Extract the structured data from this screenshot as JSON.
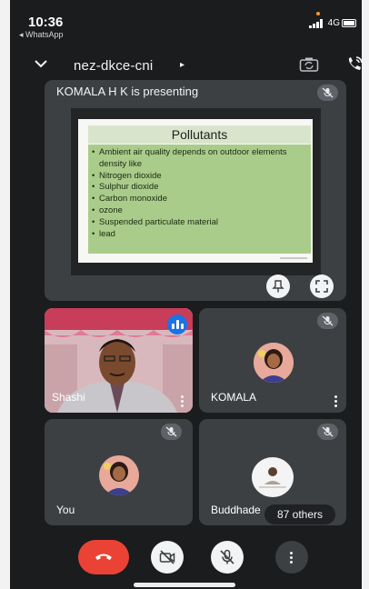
{
  "status_bar": {
    "time": "10:36",
    "back_app": "◂ WhatsApp",
    "network": "4G"
  },
  "header": {
    "meeting_code": "nez-dkce-cni",
    "arrow": "▸"
  },
  "presentation": {
    "presenter_text": "KOMALA H K is presenting",
    "slide": {
      "title": "Pollutants",
      "bullets": [
        "Ambient air quality depends on outdoor elements density like",
        "Nitrogen dioxide",
        "Sulphur dioxide",
        "Carbon monoxide",
        "ozone",
        "Suspended particulate material",
        "lead"
      ]
    }
  },
  "participants": {
    "shashi": {
      "name": "Shashi"
    },
    "komala": {
      "name": "KOMALA"
    },
    "you": {
      "name": "You"
    },
    "buddhadev": {
      "name": "Buddhade"
    },
    "others_label": "87 others"
  },
  "colors": {
    "background": "#1b1c1e",
    "tile": "#3c4043",
    "end_call": "#ea4335",
    "active_speaker": "#1a73e8",
    "slide_body": "#a9cc8a"
  },
  "icons": {
    "header": [
      "chevron-down-icon",
      "camera-flip-icon",
      "speaker-icon"
    ],
    "tiles": [
      "mic-off-icon",
      "pin-icon",
      "fullscreen-icon",
      "more-vert-icon"
    ],
    "controls": [
      "end-call-icon",
      "video-off-icon",
      "mic-off-icon",
      "more-vert-icon"
    ]
  }
}
